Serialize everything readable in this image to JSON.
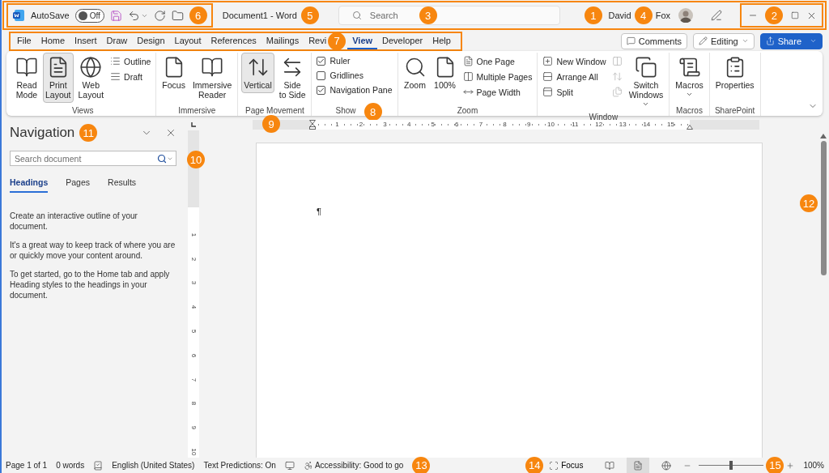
{
  "title_bar": {
    "autosave": {
      "label": "AutoSave",
      "on": false,
      "state_text": "Off"
    },
    "document_title": "Document1 - Word",
    "search": {
      "placeholder": "Search"
    },
    "user": {
      "first_name": "David",
      "last_name": "Fox"
    }
  },
  "menu_tabs": [
    {
      "label": "File",
      "selected": false
    },
    {
      "label": "Home",
      "selected": false
    },
    {
      "label": "Insert",
      "selected": false
    },
    {
      "label": "Draw",
      "selected": false
    },
    {
      "label": "Design",
      "selected": false
    },
    {
      "label": "Layout",
      "selected": false
    },
    {
      "label": "References",
      "selected": false
    },
    {
      "label": "Mailings",
      "selected": false
    },
    {
      "label": "Revi",
      "selected": false
    },
    {
      "label": "View",
      "selected": true
    },
    {
      "label": "Developer",
      "selected": false
    },
    {
      "label": "Help",
      "selected": false
    }
  ],
  "actions": {
    "comments": "Comments",
    "editing": "Editing",
    "share": "Share"
  },
  "ribbon_groups": [
    {
      "title": "Views",
      "items": [
        {
          "kind": "large",
          "label": "Read Mode",
          "selected": false
        },
        {
          "kind": "large",
          "label": "Print Layout",
          "selected": true
        },
        {
          "kind": "large",
          "label": "Web Layout",
          "selected": false
        },
        {
          "kind": "small",
          "label": "Outline",
          "selected": false
        },
        {
          "kind": "small",
          "label": "Draft",
          "selected": false
        }
      ]
    },
    {
      "title": "Immersive",
      "items": [
        {
          "kind": "large",
          "label": "Focus"
        },
        {
          "kind": "large",
          "label": "Immersive Reader"
        }
      ]
    },
    {
      "title": "Page Movement",
      "items": [
        {
          "kind": "large",
          "label": "Vertical",
          "selected": true
        },
        {
          "kind": "large",
          "label": "Side to Side",
          "selected": false
        }
      ]
    },
    {
      "title": "Show",
      "items": [
        {
          "kind": "check",
          "label": "Ruler",
          "checked": true
        },
        {
          "kind": "check",
          "label": "Gridlines",
          "checked": false
        },
        {
          "kind": "check",
          "label": "Navigation Pane",
          "checked": true
        }
      ]
    },
    {
      "title": "Zoom",
      "items": [
        {
          "kind": "large",
          "label": "Zoom"
        },
        {
          "kind": "large",
          "label": "100%"
        },
        {
          "kind": "small",
          "label": "One Page"
        },
        {
          "kind": "small",
          "label": "Multiple Pages"
        },
        {
          "kind": "small",
          "label": "Page Width"
        }
      ]
    },
    {
      "title": "Window",
      "items": [
        {
          "kind": "small",
          "label": "New Window",
          "disabled": false
        },
        {
          "kind": "small",
          "label": "Arrange All",
          "disabled": false
        },
        {
          "kind": "small",
          "label": "Split",
          "disabled": false
        },
        {
          "kind": "icon",
          "disabled": true
        },
        {
          "kind": "icon",
          "disabled": true
        },
        {
          "kind": "icon",
          "disabled": true
        },
        {
          "kind": "large",
          "label": "Switch Windows",
          "dropdown": true,
          "disabled": false
        }
      ]
    },
    {
      "title": "Macros",
      "items": [
        {
          "kind": "large",
          "label": "Macros",
          "dropdown": true
        }
      ]
    },
    {
      "title": "SharePoint",
      "items": [
        {
          "kind": "large",
          "label": "Properties"
        }
      ]
    }
  ],
  "navigation": {
    "title": "Navigation",
    "search_placeholder": "Search document",
    "tabs": [
      {
        "label": "Headings",
        "selected": true
      },
      {
        "label": "Pages",
        "selected": false
      },
      {
        "label": "Results",
        "selected": false
      }
    ],
    "paragraphs": [
      "Create an interactive outline of your document.",
      "It's a great way to keep track of where you are or quickly move your content around.",
      "To get started, go to the Home tab and apply Heading styles to the headings in your document."
    ]
  },
  "rulers": {
    "horizontal": [
      "1",
      "2",
      "3",
      "4",
      "5",
      "6",
      "7",
      "8",
      "9",
      "10",
      "11",
      "12",
      "13",
      "14",
      "15"
    ],
    "vertical": [
      "1",
      "2",
      "3",
      "4",
      "5",
      "6",
      "7",
      "8",
      "9",
      "10"
    ]
  },
  "document": {
    "paragraph_mark": "¶"
  },
  "status_bar": {
    "page": "Page 1 of 1",
    "words": "0 words",
    "language": "English (United States)",
    "predictions": "Text Predictions: On",
    "accessibility": "Accessibility: Good to go",
    "focus": "Focus",
    "views": [
      {
        "selected": false
      },
      {
        "selected": true
      },
      {
        "selected": false
      }
    ],
    "zoom": {
      "level": 0.5,
      "percent": "100%"
    }
  },
  "callouts": [
    "6",
    "5",
    "3",
    "1",
    "4",
    "2",
    "7",
    "8",
    "9",
    "11",
    "10",
    "12",
    "13",
    "14",
    "15"
  ]
}
